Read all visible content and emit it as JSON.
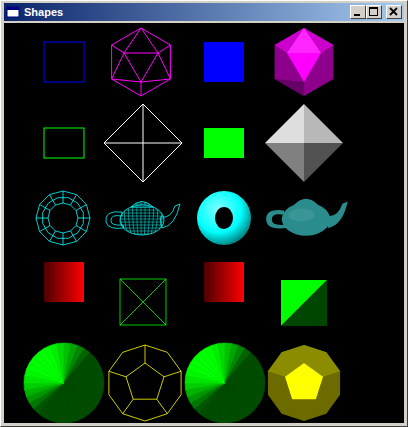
{
  "window": {
    "title": "Shapes"
  },
  "shapes": [
    {
      "kind": "wire-cube",
      "color": "#0000ff"
    },
    {
      "kind": "wire-icosahedron",
      "color": "#ff00ff"
    },
    {
      "kind": "solid-cube",
      "color": "#0000ff"
    },
    {
      "kind": "solid-icosahedron",
      "color": "#ff00ff"
    },
    {
      "kind": "wire-box",
      "color": "#00ff00"
    },
    {
      "kind": "wire-octahedron",
      "color": "#ffffff"
    },
    {
      "kind": "solid-box",
      "color": "#00ff00"
    },
    {
      "kind": "solid-octahedron",
      "color": "#ffffff"
    },
    {
      "kind": "wire-torus",
      "color": "#00ffff"
    },
    {
      "kind": "wire-teapot",
      "color": "#00ffff"
    },
    {
      "kind": "solid-torus",
      "color": "#00ffff"
    },
    {
      "kind": "solid-teapot",
      "color": "#2a8c8c"
    },
    {
      "kind": "gradient-square",
      "color": "#ff0000"
    },
    {
      "kind": "wire-tetrahedron",
      "color": "#00ff00"
    },
    {
      "kind": "gradient-square",
      "color": "#ff0000"
    },
    {
      "kind": "solid-tetrahedron",
      "color": "#00ff00"
    },
    {
      "kind": "solid-cone",
      "color": "#00ff00"
    },
    {
      "kind": "wire-dodecahedron",
      "color": "#ffff00"
    },
    {
      "kind": "solid-cone",
      "color": "#00ff00"
    },
    {
      "kind": "solid-dodecahedron",
      "color": "#ffff00"
    }
  ]
}
